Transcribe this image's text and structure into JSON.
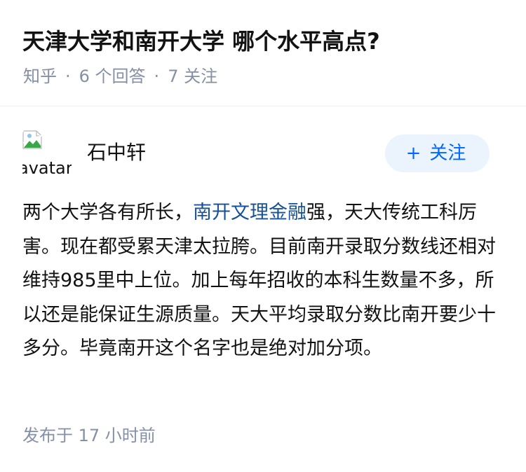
{
  "question": {
    "title": "天津大学和南开大学 哪个水平高点?",
    "source": "知乎",
    "separator": "·",
    "answers_label": "6 个回答",
    "followers_label": "7 关注"
  },
  "answer": {
    "author": {
      "name": "石中轩",
      "avatar_alt": "avatar"
    },
    "follow_button": {
      "icon": "plus-icon",
      "symbol": "+",
      "label": "关注"
    },
    "content": {
      "before_link": "两个大学各有所长，",
      "link_text": "南开文理金融",
      "after_link": "强，天大传统工科厉害。现在都受累天津太拉胯。目前南开录取分数线还相对维持985里中上位。加上每年招收的本科生数量不多，所以还是能保证生源质量。天大平均录取分数比南开要少十多分。毕竟南开这个名字也是绝对加分项。"
    },
    "published": "发布于 17 小时前"
  },
  "colors": {
    "text": "#121212",
    "meta": "#8590a6",
    "link": "#175199",
    "accent": "#0066ff",
    "button_bg": "#ebf3fc"
  }
}
